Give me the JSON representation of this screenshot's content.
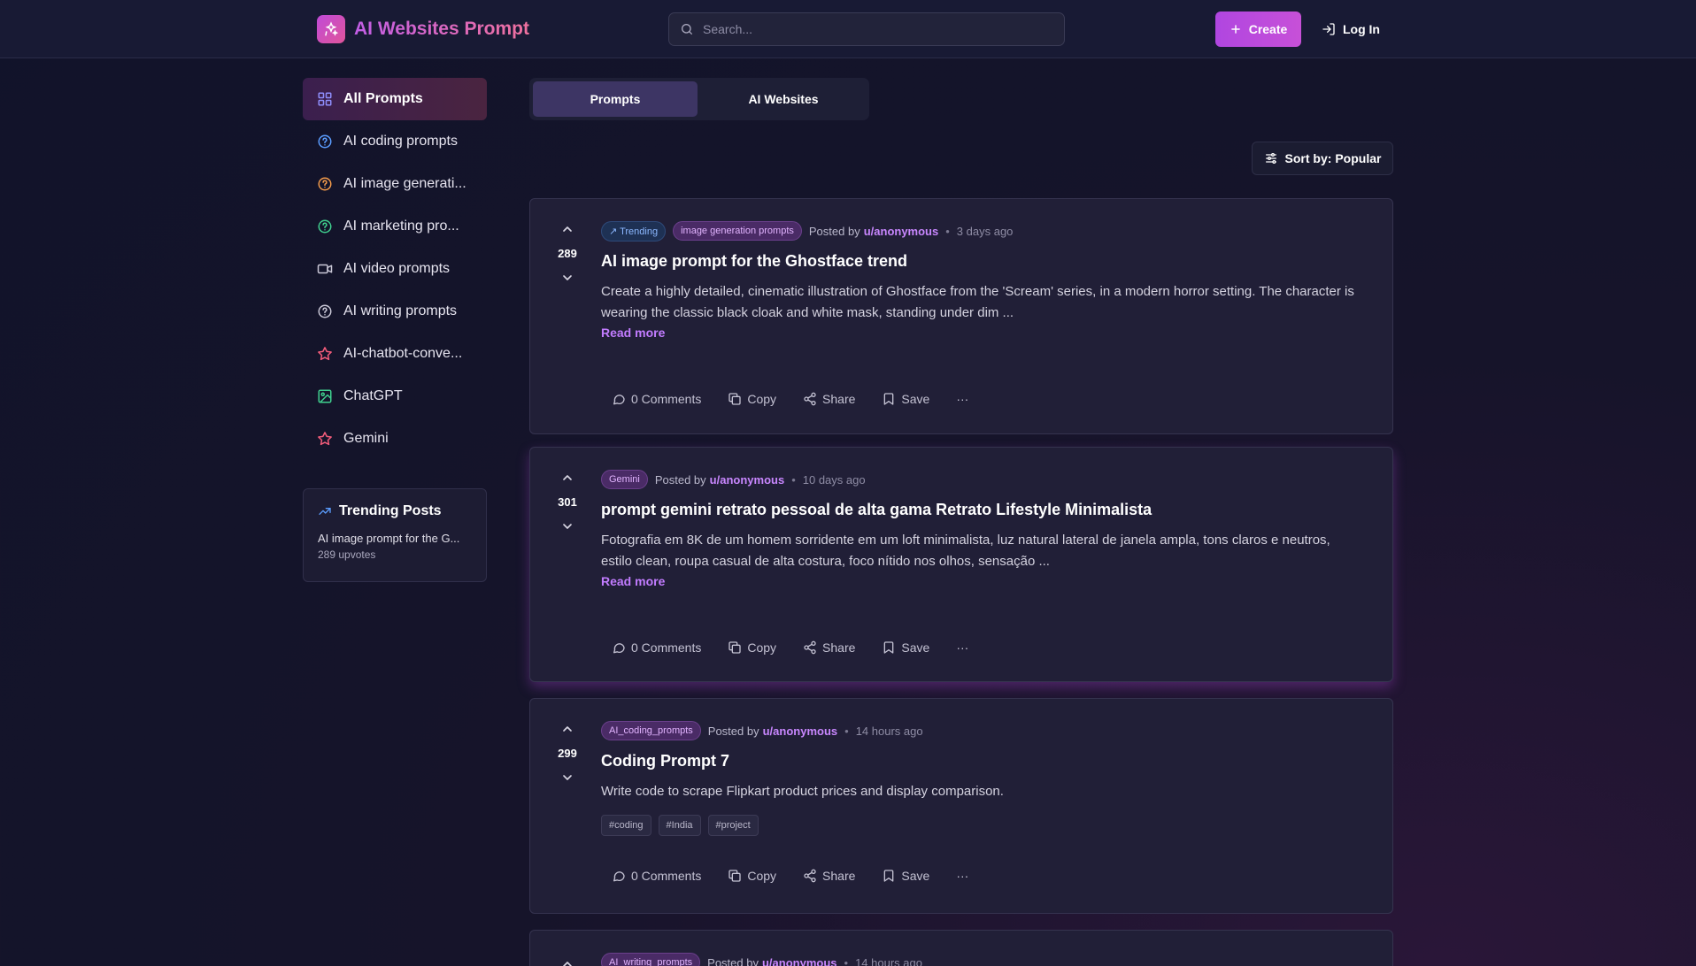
{
  "header": {
    "brand": "AI Websites Prompt",
    "search_placeholder": "Search...",
    "create_label": "Create",
    "login_label": "Log In"
  },
  "sidebar": {
    "items": [
      {
        "label": "All Prompts",
        "icon": "grid-icon",
        "color": "#8e8dfa"
      },
      {
        "label": "AI coding prompts",
        "icon": "help-circle-icon",
        "color": "#5b9dff"
      },
      {
        "label": "AI image generati...",
        "icon": "help-circle-icon",
        "color": "#f29a4a"
      },
      {
        "label": "AI marketing pro...",
        "icon": "help-circle-icon",
        "color": "#3fcf8e"
      },
      {
        "label": "AI video prompts",
        "icon": "video-icon",
        "color": "#c9c7d6"
      },
      {
        "label": "AI writing prompts",
        "icon": "help-circle-icon",
        "color": "#c9c7d6"
      },
      {
        "label": "AI-chatbot-conve...",
        "icon": "star-icon",
        "color": "#f25c7a"
      },
      {
        "label": "ChatGPT",
        "icon": "image-icon",
        "color": "#3fcf8e"
      },
      {
        "label": "Gemini",
        "icon": "star-icon",
        "color": "#f25c7a"
      }
    ]
  },
  "trending": {
    "heading": "Trending Posts",
    "item_title": "AI image prompt for the G...",
    "item_sub": "289 upvotes"
  },
  "tabs": [
    "Prompts",
    "AI Websites"
  ],
  "sort_label": "Sort by: Popular",
  "posts": [
    {
      "votes": "289",
      "trending_badge": "Trending",
      "category": "image generation prompts",
      "posted_by": "Posted by",
      "user": "u/anonymous",
      "time": "3 days ago",
      "title": "AI image prompt for the Ghostface trend",
      "desc": "Create a highly detailed, cinematic illustration of Ghostface from the 'Scream' series, in a modern horror setting. The character is wearing the classic black cloak and white mask, standing under dim ...",
      "read_more": "Read more"
    },
    {
      "votes": "301",
      "category": "Gemini",
      "posted_by": "Posted by",
      "user": "u/anonymous",
      "time": "10 days ago",
      "title": "prompt gemini retrato pessoal de alta gama Retrato Lifestyle Minimalista",
      "desc": "Fotografia em 8K de um homem sorridente em um loft minimalista, luz natural lateral de janela ampla, tons claros e neutros, estilo clean, roupa casual de alta costura, foco nítido nos olhos, sensação ...",
      "read_more": "Read more"
    },
    {
      "votes": "299",
      "category": "AI_coding_prompts",
      "posted_by": "Posted by",
      "user": "u/anonymous",
      "time": "14 hours ago",
      "title": "Coding Prompt 7",
      "desc": "Write code to scrape Flipkart product prices and display comparison.",
      "tags": [
        "#coding",
        "#India",
        "#project"
      ]
    },
    {
      "category": "AI_writing_prompts",
      "posted_by": "Posted by",
      "user": "u/anonymous",
      "time": "14 hours ago"
    }
  ],
  "actions": {
    "comments": "0 Comments",
    "copy": "Copy",
    "share": "Share",
    "save": "Save",
    "more": "···"
  }
}
